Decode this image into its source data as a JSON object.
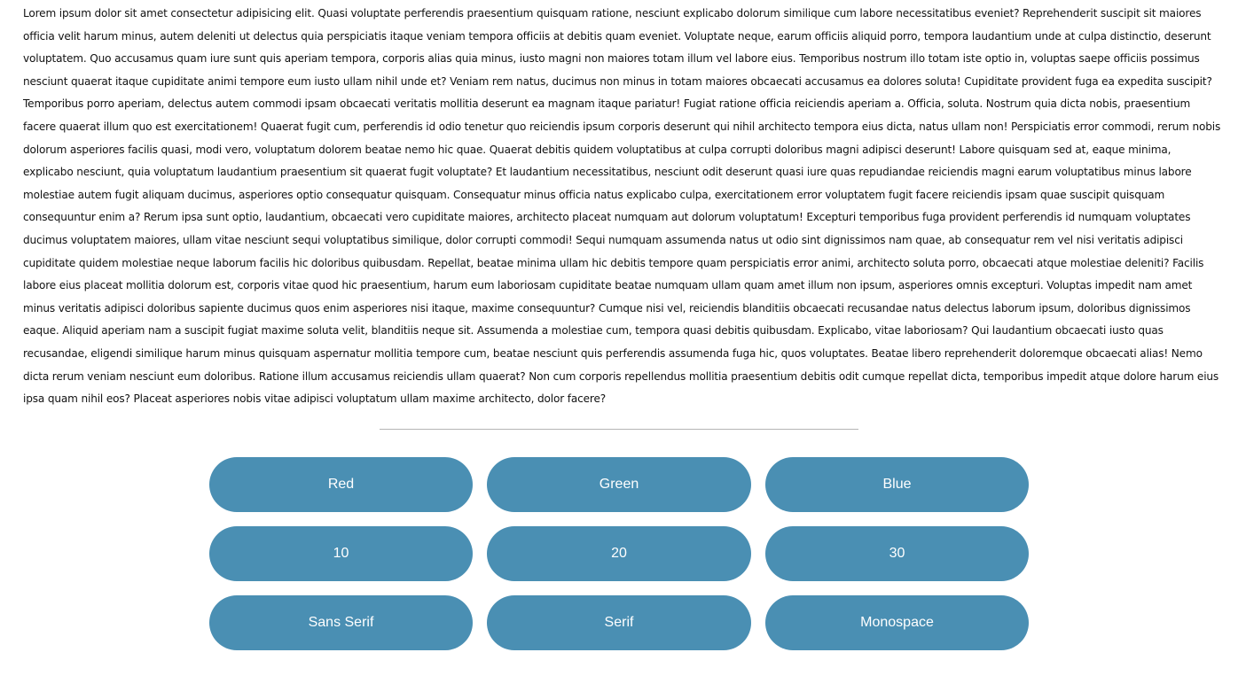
{
  "article": {
    "text": "Lorem ipsum dolor sit amet consectetur adipisicing elit. Quasi voluptate perferendis praesentium quisquam ratione, nesciunt explicabo dolorum similique cum labore necessitatibus eveniet? Reprehenderit suscipit sit maiores officia velit harum minus, autem deleniti ut delectus quia perspiciatis itaque veniam tempora officiis at debitis quam eveniet. Voluptate neque, earum officiis aliquid porro, tempora laudantium unde at culpa distinctio, deserunt voluptatem. Quo accusamus quam iure sunt quis aperiam tempora, corporis alias quia minus, iusto magni non maiores totam illum vel labore eius. Temporibus nostrum illo totam iste optio in, voluptas saepe officiis possimus nesciunt quaerat itaque cupiditate animi tempore eum iusto ullam nihil unde et? Veniam rem natus, ducimus non minus in totam maiores obcaecati accusamus ea dolores soluta! Cupiditate provident fuga ea expedita suscipit? Temporibus porro aperiam, delectus autem commodi ipsam obcaecati veritatis mollitia deserunt ea magnam itaque pariatur! Fugiat ratione officia reiciendis aperiam a. Officia, soluta. Nostrum quia dicta nobis, praesentium facere quaerat illum quo est exercitationem! Quaerat fugit cum, perferendis id odio tenetur quo reiciendis ipsum corporis deserunt qui nihil architecto tempora eius dicta, natus ullam non! Perspiciatis error commodi, rerum nobis dolorum asperiores facilis quasi, modi vero, voluptatum dolorem beatae nemo hic quae. Quaerat debitis quidem voluptatibus at culpa corrupti doloribus magni adipisci deserunt! Labore quisquam sed at, eaque minima, explicabo nesciunt, quia voluptatum laudantium praesentium sit quaerat fugit voluptate? Et laudantium necessitatibus, nesciunt odit deserunt quasi iure quas repudiandae reiciendis magni earum voluptatibus minus labore molestiae autem fugit aliquam ducimus, asperiores optio consequatur quisquam. Consequatur minus officia natus explicabo culpa, exercitationem error voluptatem fugit facere reiciendis ipsam quae suscipit quisquam consequuntur enim a? Rerum ipsa sunt optio, laudantium, obcaecati vero cupiditate maiores, architecto placeat numquam aut dolorum voluptatum! Excepturi temporibus fuga provident perferendis id numquam voluptates ducimus voluptatem maiores, ullam vitae nesciunt sequi voluptatibus similique, dolor corrupti commodi! Sequi numquam assumenda natus ut odio sint dignissimos nam quae, ab consequatur rem vel nisi veritatis adipisci cupiditate quidem molestiae neque laborum facilis hic doloribus quibusdam. Repellat, beatae minima ullam hic debitis tempore quam perspiciatis error animi, architecto soluta porro, obcaecati atque molestiae deleniti? Facilis labore eius placeat mollitia dolorum est, corporis vitae quod hic praesentium, harum eum laboriosam cupiditate beatae numquam ullam quam amet illum non ipsum, asperiores omnis excepturi. Voluptas impedit nam amet minus veritatis adipisci doloribus sapiente ducimus quos enim asperiores nisi itaque, maxime consequuntur? Cumque nisi vel, reiciendis blanditiis obcaecati recusandae natus delectus laborum ipsum, doloribus dignissimos eaque. Aliquid aperiam nam a suscipit fugiat maxime soluta velit, blanditiis neque sit. Assumenda a molestiae cum, tempora quasi debitis quibusdam. Explicabo, vitae laboriosam? Qui laudantium obcaecati iusto quas recusandae, eligendi similique harum minus quisquam aspernatur mollitia tempore cum, beatae nesciunt quis perferendis assumenda fuga hic, quos voluptates. Beatae libero reprehenderit doloremque obcaecati alias! Nemo dicta rerum veniam nesciunt eum doloribus. Ratione illum accusamus reiciendis ullam quaerat? Non cum corporis repellendus mollitia praesentium debitis odit cumque repellat dicta, temporibus impedit atque dolore harum eius ipsa quam nihil eos? Placeat asperiores nobis vitae adipisci voluptatum ullam maxime architecto, dolor facere?"
  },
  "controls": {
    "colors": [
      "Red",
      "Green",
      "Blue"
    ],
    "sizes": [
      "10",
      "20",
      "30"
    ],
    "fonts": [
      "Sans Serif",
      "Serif",
      "Monospace"
    ]
  },
  "theme": {
    "button_bg": "#4a8fb3",
    "button_text": "#ffffff",
    "divider": "#b5b5b5"
  }
}
